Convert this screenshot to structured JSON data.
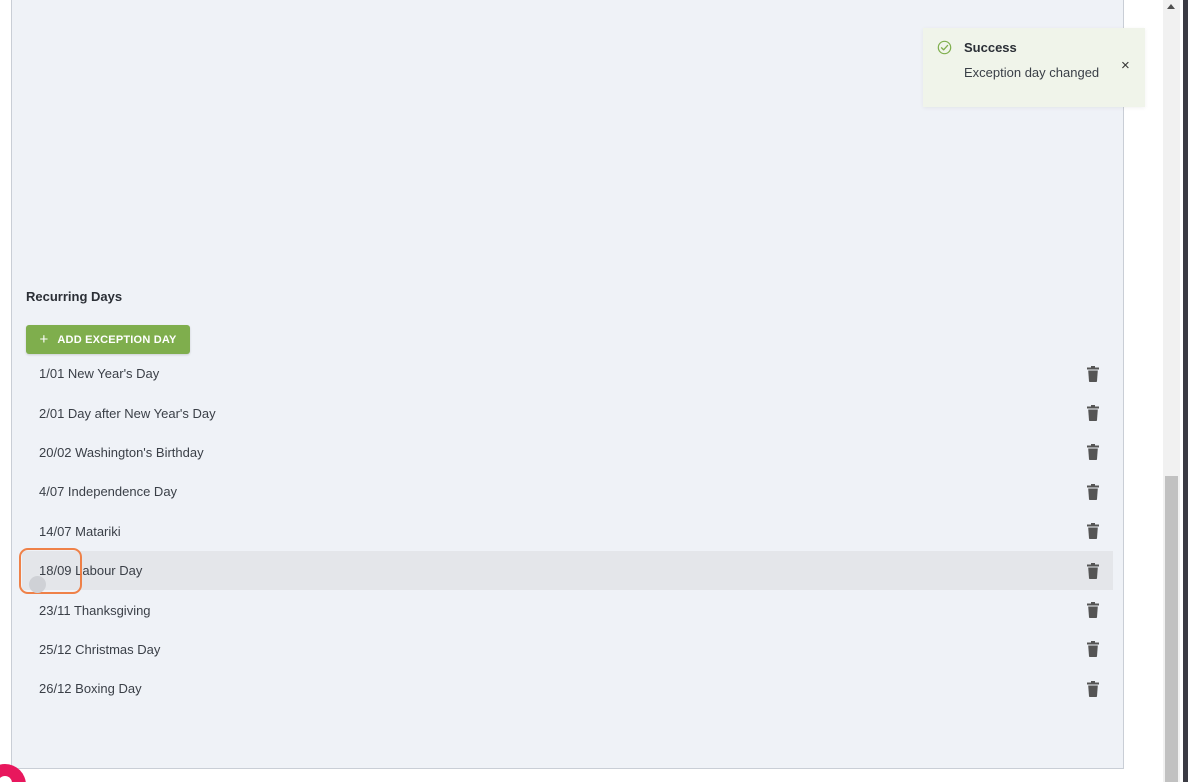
{
  "section": {
    "title": "Recurring Days"
  },
  "add_button": {
    "icon": "plus-icon",
    "label": "ADD EXCEPTION DAY"
  },
  "exception_days": [
    {
      "label": "1/01 New Year's Day"
    },
    {
      "label": "2/01 Day after New Year's Day"
    },
    {
      "label": "20/02 Washington's Birthday"
    },
    {
      "label": "4/07 Independence Day"
    },
    {
      "label": "14/07 Matariki"
    },
    {
      "label": "18/09 Labour Day"
    },
    {
      "label": "23/11 Thanksgiving"
    },
    {
      "label": "25/12 Christmas Day"
    },
    {
      "label": "26/12 Boxing Day"
    }
  ],
  "toast": {
    "title": "Success",
    "message": "Exception day changed",
    "close_glyph": "×",
    "icon": "check-circle-icon"
  },
  "colors": {
    "accent_green": "#7fae4d",
    "panel_bg": "#eff2f7",
    "toast_bg": "#f0f4ea",
    "hover_row": "#e4e6ea"
  }
}
